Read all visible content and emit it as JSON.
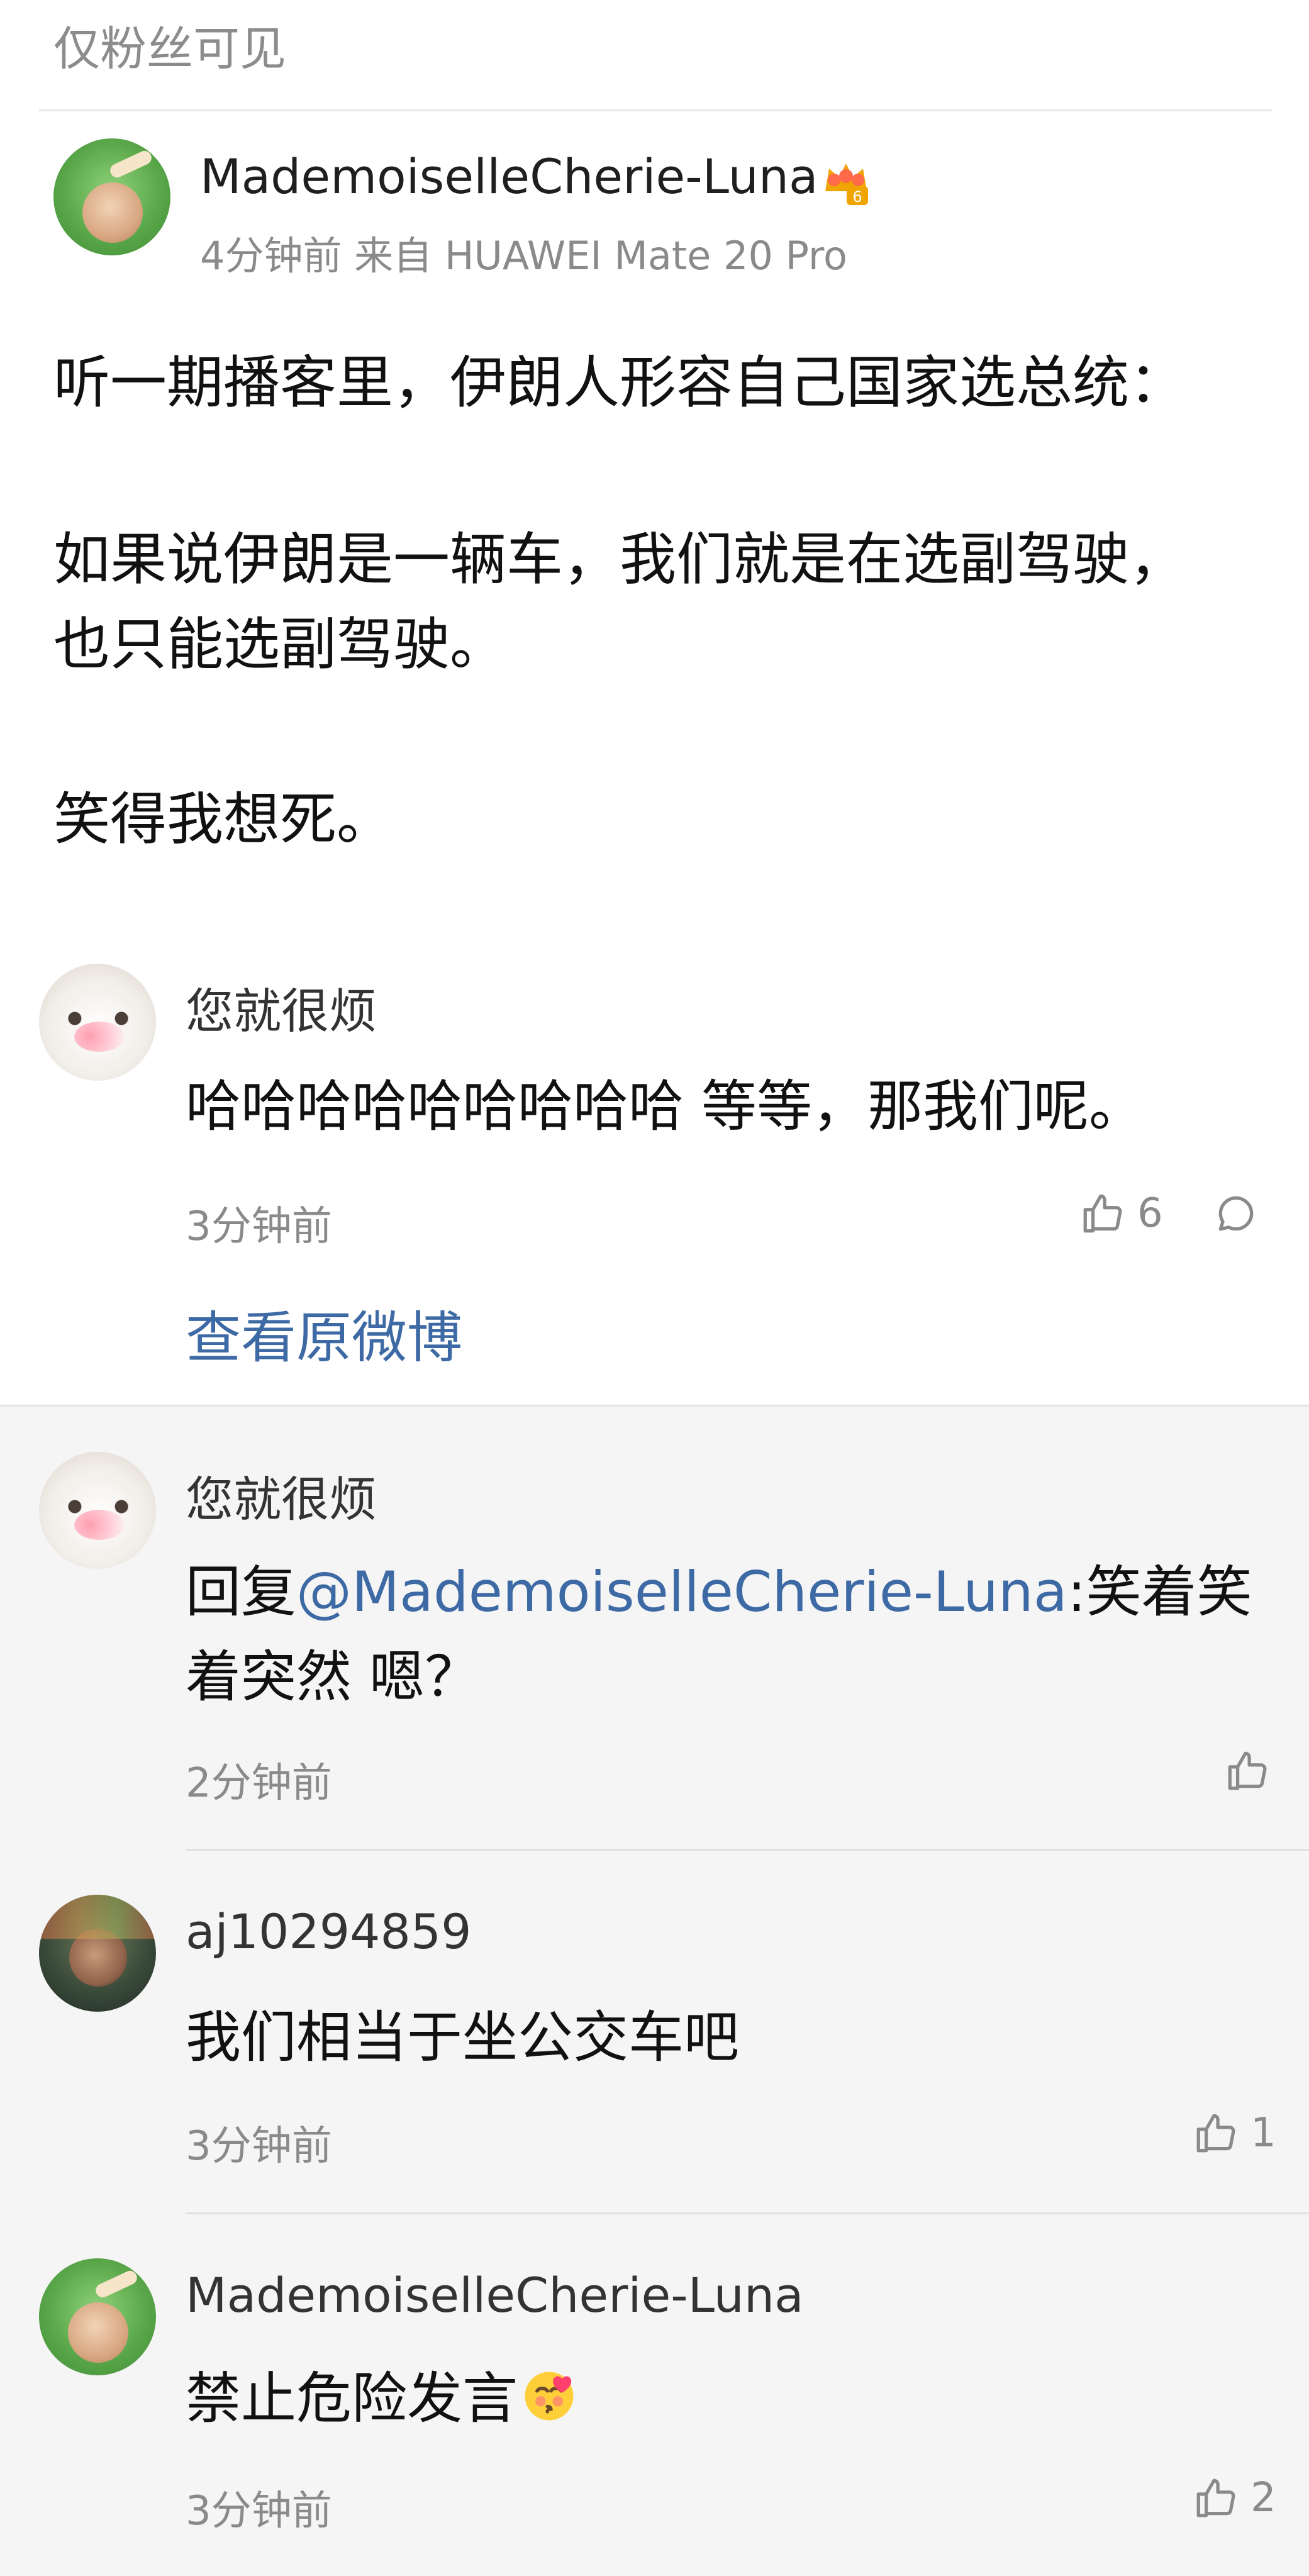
{
  "header": {
    "visibility_label": "仅粉丝可见"
  },
  "post": {
    "author": "MademoiselleCherie-Luna",
    "meta": "4分钟前 来自 HUAWEI Mate 20 Pro",
    "badge_level": "6",
    "lines": [
      "听一期播客里，伊朗人形容自己国家选总统：",
      "如果说伊朗是一辆车，我们就是在选副驾驶，",
      "也只能选副驾驶。",
      "笑得我想死。"
    ]
  },
  "top_comment": {
    "author": "您就很烦",
    "text": "哈哈哈哈哈哈哈哈哈 等等，那我们呢。",
    "time": "3分钟前",
    "likes": "6",
    "view_original": "查看原微博"
  },
  "replies": [
    {
      "author": "您就很烦",
      "reply_prefix": "回复",
      "mention": "@MademoiselleCherie-Luna",
      "text_line1_rest": ":笑着笑",
      "text_line2": "着突然 嗯？",
      "time": "2分钟前"
    },
    {
      "author": "aj10294859",
      "text": "我们相当于坐公交车吧",
      "time": "3分钟前",
      "likes": "1"
    },
    {
      "author": "MademoiselleCherie-Luna",
      "text": "禁止危险发言",
      "time": "3分钟前",
      "likes": "2"
    }
  ],
  "icons": {
    "like": "thumbs-up-icon",
    "comment": "speech-bubble-icon",
    "badge": "crown-badge-icon",
    "emoji": "kiss-face-emoji"
  },
  "colors": {
    "link": "#3d6aa4",
    "muted": "#8a8a8a",
    "gray_section": "#f5f5f5"
  }
}
